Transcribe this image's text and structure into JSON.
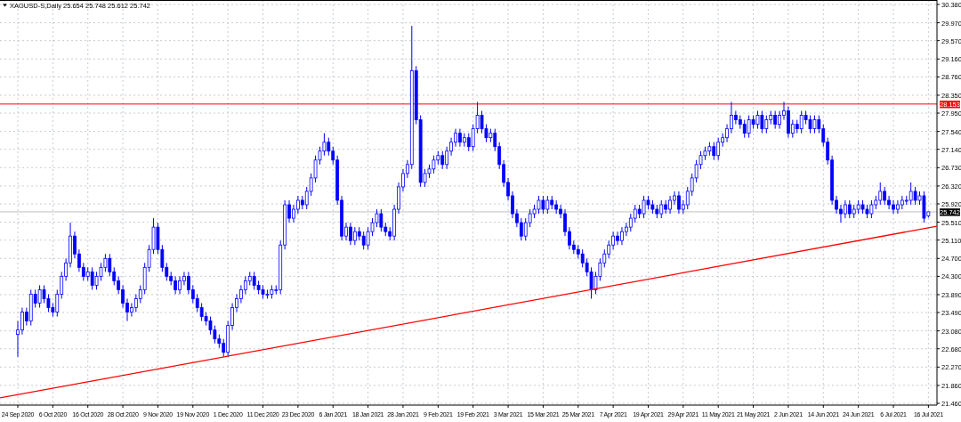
{
  "chart_data": {
    "type": "candlestick",
    "title": "XAGUSD-S,Daily 25.654 25.748 25.612 25.742",
    "categories": [
      "24 Sep 2020",
      null,
      null,
      null,
      null,
      null,
      null,
      null,
      "6 Oct 2020",
      null,
      null,
      null,
      null,
      null,
      null,
      null,
      "16 Oct 2020",
      null,
      null,
      null,
      null,
      null,
      null,
      null,
      "28 Oct 2020",
      null,
      null,
      null,
      null,
      null,
      null,
      null,
      "9 Nov 2020",
      null,
      null,
      null,
      null,
      null,
      null,
      null,
      "19 Nov 2020",
      null,
      null,
      null,
      null,
      null,
      null,
      null,
      "1 Dec 2020",
      null,
      null,
      null,
      null,
      null,
      null,
      null,
      "11 Dec 2020",
      null,
      null,
      null,
      null,
      null,
      null,
      null,
      "23 Dec 2020",
      null,
      null,
      null,
      null,
      null,
      null,
      null,
      "6 Jan 2021",
      null,
      null,
      null,
      null,
      null,
      null,
      null,
      "18 Jan 2021",
      null,
      null,
      null,
      null,
      null,
      null,
      null,
      "28 Jan 2021",
      null,
      null,
      null,
      null,
      null,
      null,
      null,
      "9 Feb 2021",
      null,
      null,
      null,
      null,
      null,
      null,
      null,
      "19 Feb 2021",
      null,
      null,
      null,
      null,
      null,
      null,
      null,
      "3 Mar 2021",
      null,
      null,
      null,
      null,
      null,
      null,
      null,
      "15 Mar 2021",
      null,
      null,
      null,
      null,
      null,
      null,
      null,
      "25 Mar 2021",
      null,
      null,
      null,
      null,
      null,
      null,
      null,
      "7 Apr 2021",
      null,
      null,
      null,
      null,
      null,
      null,
      null,
      "19 Apr 2021",
      null,
      null,
      null,
      null,
      null,
      null,
      null,
      "29 Apr 2021",
      null,
      null,
      null,
      null,
      null,
      null,
      null,
      "11 May 2021",
      null,
      null,
      null,
      null,
      null,
      null,
      null,
      "21 May 2021",
      null,
      null,
      null,
      null,
      null,
      null,
      null,
      "2 Jun 2021",
      null,
      null,
      null,
      null,
      null,
      null,
      null,
      "14 Jun 2021",
      null,
      null,
      null,
      null,
      null,
      null,
      null,
      "24 Jun 2021",
      null,
      null,
      null,
      null,
      null,
      null,
      null,
      "6 Jul 2021",
      null,
      null,
      null,
      null,
      null,
      null,
      null,
      "16 Jul 2021"
    ],
    "ohlc": [
      [
        23.0,
        23.3,
        22.5,
        23.1
      ],
      [
        23.1,
        23.6,
        23.0,
        23.5
      ],
      [
        23.5,
        23.6,
        23.2,
        23.3
      ],
      [
        23.3,
        24.0,
        23.2,
        23.9
      ],
      [
        23.9,
        24.0,
        23.6,
        23.7
      ],
      [
        23.7,
        24.1,
        23.6,
        24.0
      ],
      [
        24.0,
        24.1,
        23.7,
        23.8
      ],
      [
        23.8,
        23.9,
        23.5,
        23.6
      ],
      [
        23.6,
        23.7,
        23.4,
        23.5
      ],
      [
        23.5,
        24.0,
        23.4,
        23.9
      ],
      [
        23.9,
        24.4,
        23.8,
        24.3
      ],
      [
        24.3,
        24.7,
        24.2,
        24.6
      ],
      [
        24.6,
        25.5,
        24.5,
        25.2
      ],
      [
        25.2,
        25.3,
        24.7,
        24.8
      ],
      [
        24.8,
        24.9,
        24.4,
        24.5
      ],
      [
        24.5,
        24.6,
        24.2,
        24.3
      ],
      [
        24.3,
        24.5,
        24.2,
        24.4
      ],
      [
        24.4,
        24.5,
        24.0,
        24.1
      ],
      [
        24.1,
        24.4,
        24.0,
        24.3
      ],
      [
        24.3,
        24.6,
        24.2,
        24.5
      ],
      [
        24.5,
        24.8,
        24.4,
        24.7
      ],
      [
        24.7,
        24.8,
        24.3,
        24.4
      ],
      [
        24.4,
        24.5,
        24.1,
        24.2
      ],
      [
        24.2,
        24.3,
        23.9,
        24.0
      ],
      [
        24.0,
        24.1,
        23.6,
        23.7
      ],
      [
        23.7,
        23.8,
        23.3,
        23.5
      ],
      [
        23.5,
        23.7,
        23.4,
        23.6
      ],
      [
        23.6,
        23.9,
        23.5,
        23.8
      ],
      [
        23.8,
        24.1,
        23.7,
        24.0
      ],
      [
        24.0,
        24.6,
        23.9,
        24.5
      ],
      [
        24.5,
        25.0,
        24.4,
        24.9
      ],
      [
        24.9,
        25.6,
        24.8,
        25.4
      ],
      [
        25.4,
        25.5,
        24.8,
        24.9
      ],
      [
        24.9,
        25.0,
        24.4,
        24.5
      ],
      [
        24.5,
        24.6,
        24.2,
        24.3
      ],
      [
        24.3,
        24.4,
        24.1,
        24.2
      ],
      [
        24.2,
        24.3,
        23.9,
        24.0
      ],
      [
        24.0,
        24.3,
        23.9,
        24.2
      ],
      [
        24.2,
        24.4,
        24.1,
        24.3
      ],
      [
        24.3,
        24.4,
        23.9,
        24.0
      ],
      [
        24.0,
        24.1,
        23.7,
        23.8
      ],
      [
        23.8,
        23.9,
        23.5,
        23.6
      ],
      [
        23.6,
        23.7,
        23.3,
        23.4
      ],
      [
        23.4,
        23.5,
        23.2,
        23.3
      ],
      [
        23.3,
        23.4,
        23.0,
        23.1
      ],
      [
        23.1,
        23.2,
        22.8,
        22.9
      ],
      [
        22.9,
        23.0,
        22.7,
        22.8
      ],
      [
        22.8,
        22.9,
        22.5,
        22.6
      ],
      [
        22.6,
        23.3,
        22.5,
        23.2
      ],
      [
        23.2,
        23.7,
        23.1,
        23.6
      ],
      [
        23.6,
        23.9,
        23.5,
        23.8
      ],
      [
        23.8,
        24.1,
        23.7,
        24.0
      ],
      [
        24.0,
        24.3,
        23.9,
        24.2
      ],
      [
        24.2,
        24.4,
        24.1,
        24.3
      ],
      [
        24.3,
        24.4,
        24.0,
        24.1
      ],
      [
        24.1,
        24.2,
        23.9,
        24.0
      ],
      [
        24.0,
        24.1,
        23.8,
        23.9
      ],
      [
        23.9,
        24.0,
        23.8,
        23.9
      ],
      [
        23.9,
        24.1,
        23.8,
        24.0
      ],
      [
        24.0,
        24.1,
        23.9,
        24.0
      ],
      [
        24.0,
        25.1,
        23.9,
        25.0
      ],
      [
        25.0,
        26.0,
        24.9,
        25.9
      ],
      [
        25.9,
        26.0,
        25.5,
        25.6
      ],
      [
        25.6,
        25.9,
        25.5,
        25.8
      ],
      [
        25.8,
        26.1,
        25.7,
        26.0
      ],
      [
        26.0,
        26.1,
        25.8,
        25.9
      ],
      [
        25.9,
        26.3,
        25.8,
        26.2
      ],
      [
        26.2,
        26.6,
        26.1,
        26.5
      ],
      [
        26.5,
        27.0,
        26.4,
        26.9
      ],
      [
        26.9,
        27.2,
        26.8,
        27.1
      ],
      [
        27.1,
        27.5,
        27.0,
        27.3
      ],
      [
        27.3,
        27.4,
        27.0,
        27.1
      ],
      [
        27.1,
        27.2,
        26.8,
        26.9
      ],
      [
        26.9,
        27.0,
        25.9,
        26.0
      ],
      [
        26.0,
        26.1,
        25.1,
        25.2
      ],
      [
        25.2,
        25.5,
        25.1,
        25.4
      ],
      [
        25.4,
        25.5,
        25.0,
        25.1
      ],
      [
        25.1,
        25.4,
        25.0,
        25.3
      ],
      [
        25.3,
        25.4,
        25.1,
        25.2
      ],
      [
        25.2,
        25.3,
        24.9,
        25.0
      ],
      [
        25.0,
        25.4,
        24.9,
        25.3
      ],
      [
        25.3,
        25.6,
        25.2,
        25.5
      ],
      [
        25.5,
        25.8,
        25.4,
        25.7
      ],
      [
        25.7,
        25.8,
        25.3,
        25.4
      ],
      [
        25.4,
        25.5,
        25.2,
        25.3
      ],
      [
        25.3,
        25.4,
        25.1,
        25.2
      ],
      [
        25.2,
        25.9,
        25.1,
        25.8
      ],
      [
        25.8,
        26.4,
        25.7,
        26.3
      ],
      [
        26.3,
        26.7,
        26.2,
        26.6
      ],
      [
        26.6,
        26.9,
        26.5,
        26.8
      ],
      [
        26.8,
        29.9,
        26.7,
        28.9
      ],
      [
        28.9,
        29.0,
        27.7,
        27.8
      ],
      [
        27.8,
        27.9,
        26.3,
        26.4
      ],
      [
        26.4,
        26.7,
        26.3,
        26.6
      ],
      [
        26.6,
        26.8,
        26.5,
        26.7
      ],
      [
        26.7,
        27.0,
        26.6,
        26.9
      ],
      [
        26.9,
        27.1,
        26.8,
        27.0
      ],
      [
        27.0,
        27.1,
        26.7,
        26.8
      ],
      [
        26.8,
        27.2,
        26.7,
        27.1
      ],
      [
        27.1,
        27.4,
        27.0,
        27.3
      ],
      [
        27.3,
        27.6,
        27.2,
        27.5
      ],
      [
        27.5,
        27.6,
        27.2,
        27.3
      ],
      [
        27.3,
        27.5,
        27.2,
        27.4
      ],
      [
        27.4,
        27.5,
        27.1,
        27.2
      ],
      [
        27.2,
        27.7,
        27.1,
        27.6
      ],
      [
        27.6,
        28.2,
        27.5,
        27.9
      ],
      [
        27.9,
        28.0,
        27.5,
        27.6
      ],
      [
        27.6,
        27.7,
        27.3,
        27.4
      ],
      [
        27.4,
        27.6,
        27.3,
        27.5
      ],
      [
        27.5,
        27.6,
        27.1,
        27.2
      ],
      [
        27.2,
        27.3,
        26.7,
        26.8
      ],
      [
        26.8,
        26.9,
        26.3,
        26.4
      ],
      [
        26.4,
        26.5,
        26.0,
        26.1
      ],
      [
        26.1,
        26.2,
        25.6,
        25.7
      ],
      [
        25.7,
        25.8,
        25.4,
        25.5
      ],
      [
        25.5,
        25.6,
        25.1,
        25.2
      ],
      [
        25.2,
        25.6,
        25.1,
        25.5
      ],
      [
        25.5,
        25.8,
        25.4,
        25.7
      ],
      [
        25.7,
        25.9,
        25.6,
        25.8
      ],
      [
        25.8,
        26.1,
        25.7,
        26.0
      ],
      [
        26.0,
        26.1,
        25.7,
        25.8
      ],
      [
        25.8,
        26.1,
        25.7,
        26.0
      ],
      [
        26.0,
        26.1,
        25.8,
        25.9
      ],
      [
        25.9,
        26.0,
        25.7,
        25.8
      ],
      [
        25.8,
        25.9,
        25.6,
        25.7
      ],
      [
        25.7,
        25.8,
        25.2,
        25.3
      ],
      [
        25.3,
        25.4,
        24.9,
        25.0
      ],
      [
        25.0,
        25.1,
        24.8,
        24.9
      ],
      [
        24.9,
        25.0,
        24.7,
        24.8
      ],
      [
        24.8,
        24.9,
        24.5,
        24.6
      ],
      [
        24.6,
        24.7,
        24.3,
        24.4
      ],
      [
        24.4,
        24.5,
        23.8,
        24.0
      ],
      [
        24.0,
        24.4,
        23.9,
        24.3
      ],
      [
        24.3,
        24.7,
        24.2,
        24.6
      ],
      [
        24.6,
        24.9,
        24.5,
        24.8
      ],
      [
        24.8,
        25.1,
        24.7,
        25.0
      ],
      [
        25.0,
        25.3,
        24.9,
        25.2
      ],
      [
        25.2,
        25.3,
        25.0,
        25.1
      ],
      [
        25.1,
        25.4,
        25.0,
        25.3
      ],
      [
        25.3,
        25.5,
        25.2,
        25.4
      ],
      [
        25.4,
        25.7,
        25.3,
        25.6
      ],
      [
        25.6,
        25.9,
        25.5,
        25.8
      ],
      [
        25.8,
        25.9,
        25.6,
        25.7
      ],
      [
        25.7,
        26.1,
        25.6,
        26.0
      ],
      [
        26.0,
        26.1,
        25.8,
        25.9
      ],
      [
        25.9,
        26.0,
        25.7,
        25.8
      ],
      [
        25.8,
        25.9,
        25.6,
        25.7
      ],
      [
        25.7,
        26.0,
        25.6,
        25.9
      ],
      [
        25.9,
        26.0,
        25.7,
        25.8
      ],
      [
        25.8,
        26.1,
        25.7,
        26.0
      ],
      [
        26.0,
        26.2,
        25.9,
        26.1
      ],
      [
        26.1,
        26.2,
        25.7,
        25.8
      ],
      [
        25.8,
        26.0,
        25.7,
        25.9
      ],
      [
        25.9,
        26.3,
        25.8,
        26.2
      ],
      [
        26.2,
        26.6,
        26.1,
        26.5
      ],
      [
        26.5,
        26.9,
        26.4,
        26.8
      ],
      [
        26.8,
        27.1,
        26.7,
        27.0
      ],
      [
        27.0,
        27.2,
        26.9,
        27.1
      ],
      [
        27.1,
        27.3,
        27.0,
        27.2
      ],
      [
        27.2,
        27.3,
        26.9,
        27.0
      ],
      [
        27.0,
        27.4,
        26.9,
        27.3
      ],
      [
        27.3,
        27.5,
        27.2,
        27.4
      ],
      [
        27.4,
        27.7,
        27.3,
        27.6
      ],
      [
        27.6,
        28.2,
        27.5,
        27.9
      ],
      [
        27.9,
        28.0,
        27.7,
        27.8
      ],
      [
        27.8,
        27.9,
        27.6,
        27.7
      ],
      [
        27.7,
        27.8,
        27.4,
        27.5
      ],
      [
        27.5,
        27.9,
        27.4,
        27.8
      ],
      [
        27.8,
        27.9,
        27.6,
        27.7
      ],
      [
        27.7,
        28.0,
        27.6,
        27.9
      ],
      [
        27.9,
        28.0,
        27.5,
        27.6
      ],
      [
        27.6,
        27.9,
        27.5,
        27.8
      ],
      [
        27.8,
        28.0,
        27.7,
        27.9
      ],
      [
        27.9,
        28.0,
        27.6,
        27.7
      ],
      [
        27.7,
        28.0,
        27.6,
        27.9
      ],
      [
        27.9,
        28.2,
        27.8,
        28.0
      ],
      [
        28.0,
        28.1,
        27.4,
        27.5
      ],
      [
        27.5,
        27.8,
        27.4,
        27.7
      ],
      [
        27.7,
        27.8,
        27.5,
        27.6
      ],
      [
        27.6,
        28.0,
        27.5,
        27.9
      ],
      [
        27.9,
        28.0,
        27.7,
        27.8
      ],
      [
        27.8,
        27.9,
        27.5,
        27.6
      ],
      [
        27.6,
        27.9,
        27.5,
        27.8
      ],
      [
        27.8,
        27.9,
        27.5,
        27.6
      ],
      [
        27.6,
        27.7,
        27.2,
        27.3
      ],
      [
        27.3,
        27.4,
        26.8,
        26.9
      ],
      [
        26.9,
        27.0,
        25.9,
        26.0
      ],
      [
        26.0,
        26.1,
        25.7,
        25.8
      ],
      [
        25.8,
        25.9,
        25.5,
        25.7
      ],
      [
        25.7,
        26.0,
        25.6,
        25.9
      ],
      [
        25.9,
        26.0,
        25.6,
        25.7
      ],
      [
        25.7,
        25.9,
        25.6,
        25.8
      ],
      [
        25.8,
        26.0,
        25.7,
        25.9
      ],
      [
        25.9,
        26.0,
        25.7,
        25.8
      ],
      [
        25.8,
        25.9,
        25.6,
        25.7
      ],
      [
        25.7,
        26.0,
        25.6,
        25.9
      ],
      [
        25.9,
        26.1,
        25.8,
        26.0
      ],
      [
        26.0,
        26.4,
        25.9,
        26.2
      ],
      [
        26.2,
        26.3,
        25.9,
        26.0
      ],
      [
        26.0,
        26.1,
        25.8,
        25.9
      ],
      [
        25.9,
        26.0,
        25.7,
        25.8
      ],
      [
        25.8,
        26.0,
        25.7,
        25.9
      ],
      [
        25.9,
        26.1,
        25.8,
        26.0
      ],
      [
        26.0,
        26.1,
        25.9,
        26.0
      ],
      [
        26.0,
        26.4,
        25.9,
        26.2
      ],
      [
        26.2,
        26.3,
        25.9,
        26.0
      ],
      [
        26.0,
        26.2,
        25.9,
        26.1
      ],
      [
        26.1,
        26.2,
        25.5,
        25.6
      ],
      [
        25.654,
        25.748,
        25.612,
        25.742
      ]
    ],
    "ylim": [
      21.46,
      30.38
    ],
    "yticks": [
      {
        "value": 30.38,
        "label": "30.380"
      },
      {
        "value": 29.97,
        "label": "29.970"
      },
      {
        "value": 29.57,
        "label": "29.570"
      },
      {
        "value": 29.16,
        "label": "29.160"
      },
      {
        "value": 28.76,
        "label": "28.760"
      },
      {
        "value": 28.35,
        "label": "28.350"
      },
      {
        "value": 27.95,
        "label": "27.950"
      },
      {
        "value": 27.54,
        "label": "27.540"
      },
      {
        "value": 27.14,
        "label": "27.140"
      },
      {
        "value": 26.73,
        "label": "26.730"
      },
      {
        "value": 26.32,
        "label": "26.320"
      },
      {
        "value": 25.92,
        "label": "25.920"
      },
      {
        "value": 25.51,
        "label": "25.510"
      },
      {
        "value": 25.11,
        "label": "25.110"
      },
      {
        "value": 24.7,
        "label": "24.700"
      },
      {
        "value": 24.3,
        "label": "24.300"
      },
      {
        "value": 23.89,
        "label": "23.890"
      },
      {
        "value": 23.49,
        "label": "23.490"
      },
      {
        "value": 23.08,
        "label": "23.080"
      },
      {
        "value": 22.68,
        "label": "22.680"
      },
      {
        "value": 22.27,
        "label": "22.270"
      },
      {
        "value": 21.86,
        "label": "21.860"
      },
      {
        "value": 21.46,
        "label": "21.460"
      }
    ],
    "grid": true,
    "ref_lines": [
      {
        "axis": "y",
        "value": 28.153,
        "label": "28.153",
        "color": "#ff0000"
      },
      {
        "axis": "y",
        "value": 25.742,
        "label": "25.742",
        "color": "#c0c0c0"
      }
    ]
  },
  "trend_line": {
    "color": "#ff0000"
  }
}
